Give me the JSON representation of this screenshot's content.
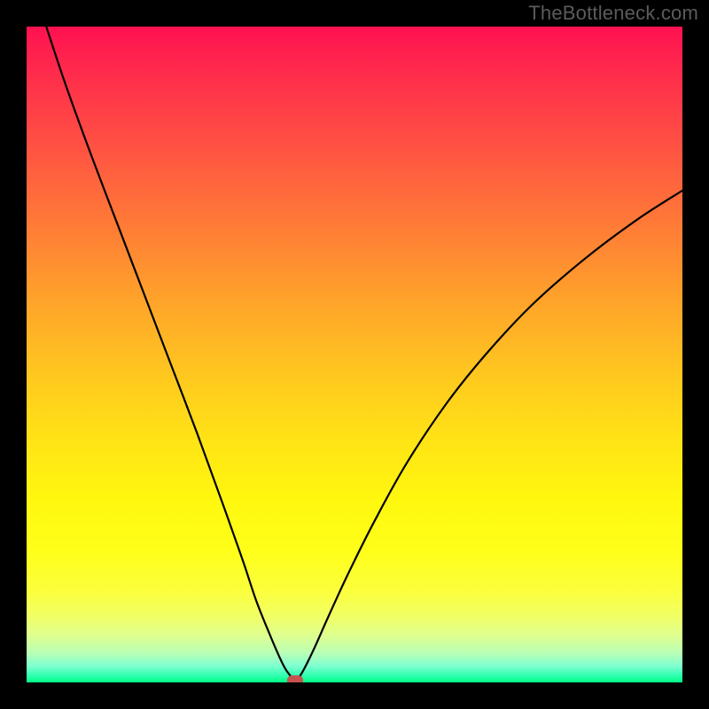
{
  "watermark": "TheBottleneck.com",
  "chart_data": {
    "type": "line",
    "title": "",
    "xlabel": "",
    "ylabel": "",
    "xlim": [
      0,
      100
    ],
    "ylim": [
      0,
      100
    ],
    "grid": false,
    "legend": false,
    "background_gradient": {
      "top": "#ff1151",
      "mid": "#ffe316",
      "bottom": "#00ff86"
    },
    "series": [
      {
        "name": "bottleneck-curve",
        "color": "#000000",
        "x": [
          3,
          6,
          10,
          14,
          18,
          22,
          26,
          30,
          33,
          35,
          37,
          38.5,
          39.5,
          40.5,
          41,
          41.5,
          42.5,
          44,
          46,
          49,
          53,
          58,
          64,
          70,
          77,
          85,
          93,
          100
        ],
        "y": [
          100,
          91,
          80,
          69.5,
          59,
          48.5,
          38,
          27,
          18.5,
          12.5,
          7.5,
          4,
          2,
          0.7,
          0.3,
          0.7,
          2.4,
          5.5,
          10,
          16.5,
          24.5,
          33.5,
          42.5,
          50,
          57.5,
          64.5,
          70.5,
          75
        ]
      }
    ],
    "marker": {
      "x": 41,
      "y": 0.3,
      "color": "#c5534f"
    }
  }
}
